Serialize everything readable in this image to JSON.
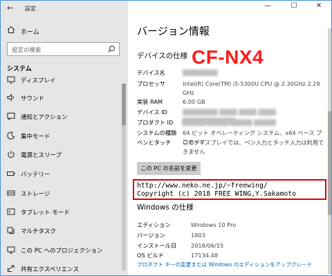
{
  "app": {
    "title": "設定"
  },
  "window_controls": {
    "minimize": "—",
    "maximize": "☐",
    "close": "✕"
  },
  "sidebar": {
    "home_label": "ホーム",
    "search_placeholder": "設定の検索",
    "section_title": "システム",
    "items": [
      {
        "label": "ディスプレイ",
        "icon": "display-icon"
      },
      {
        "label": "サウンド",
        "icon": "speaker-icon"
      },
      {
        "label": "通知とアクション",
        "icon": "notification-icon"
      },
      {
        "label": "集中モード",
        "icon": "moon-icon"
      },
      {
        "label": "電源とスリープ",
        "icon": "power-icon"
      },
      {
        "label": "バッテリー",
        "icon": "battery-icon"
      },
      {
        "label": "ストレージ",
        "icon": "storage-icon"
      },
      {
        "label": "タブレット モード",
        "icon": "tablet-icon"
      },
      {
        "label": "マルチタスク",
        "icon": "multitask-icon"
      },
      {
        "label": "この PC へのプロジェクション",
        "icon": "projection-icon"
      },
      {
        "label": "共有エクスペリエンス",
        "icon": "share-icon"
      }
    ]
  },
  "main": {
    "page_title": "バージョン情報",
    "device_spec_title": "デバイスの仕様",
    "model_overlay": "CF-NX4",
    "device_rows": [
      {
        "key": "デバイス名",
        "value": "",
        "blurred": true
      },
      {
        "key": "プロセッサ",
        "value": "Intel(R) Core(TM) i5-5300U CPU @ 2.30GHz 2.29 GHz",
        "blurred": false
      },
      {
        "key": "実装 RAM",
        "value": "6.00 GB",
        "blurred": false
      },
      {
        "key": "デバイス ID",
        "value": "",
        "blurred": true
      },
      {
        "key": "プロダクト ID",
        "value": "",
        "blurred": true
      },
      {
        "key": "システムの種類",
        "value": "64 ビット オペレーティング システム、x64 ベース プロセッサ",
        "blurred": false
      },
      {
        "key": "ペンとタッチ",
        "value": "このディスプレイでは、ペン入力とタッチ入力は利用できません",
        "blurred": false
      }
    ],
    "rename_button": "この PC の名前を変更",
    "copyright_line1": "http://www.neko.ne.jp/~freewing/",
    "copyright_line2": "Copyright (c) 2018 FREE WING,Y.Sakamoto",
    "windows_spec_title": "Windows の仕様",
    "windows_rows": [
      {
        "key": "エディション",
        "value": "Windows 10 Pro"
      },
      {
        "key": "バージョン",
        "value": "1803"
      },
      {
        "key": "インストール日",
        "value": "2018/06/15"
      },
      {
        "key": "OS ビルド",
        "value": "17134.48"
      }
    ],
    "upgrade_link": "プロダクト キーの変更または Windows のエディションをアップグレード"
  }
}
